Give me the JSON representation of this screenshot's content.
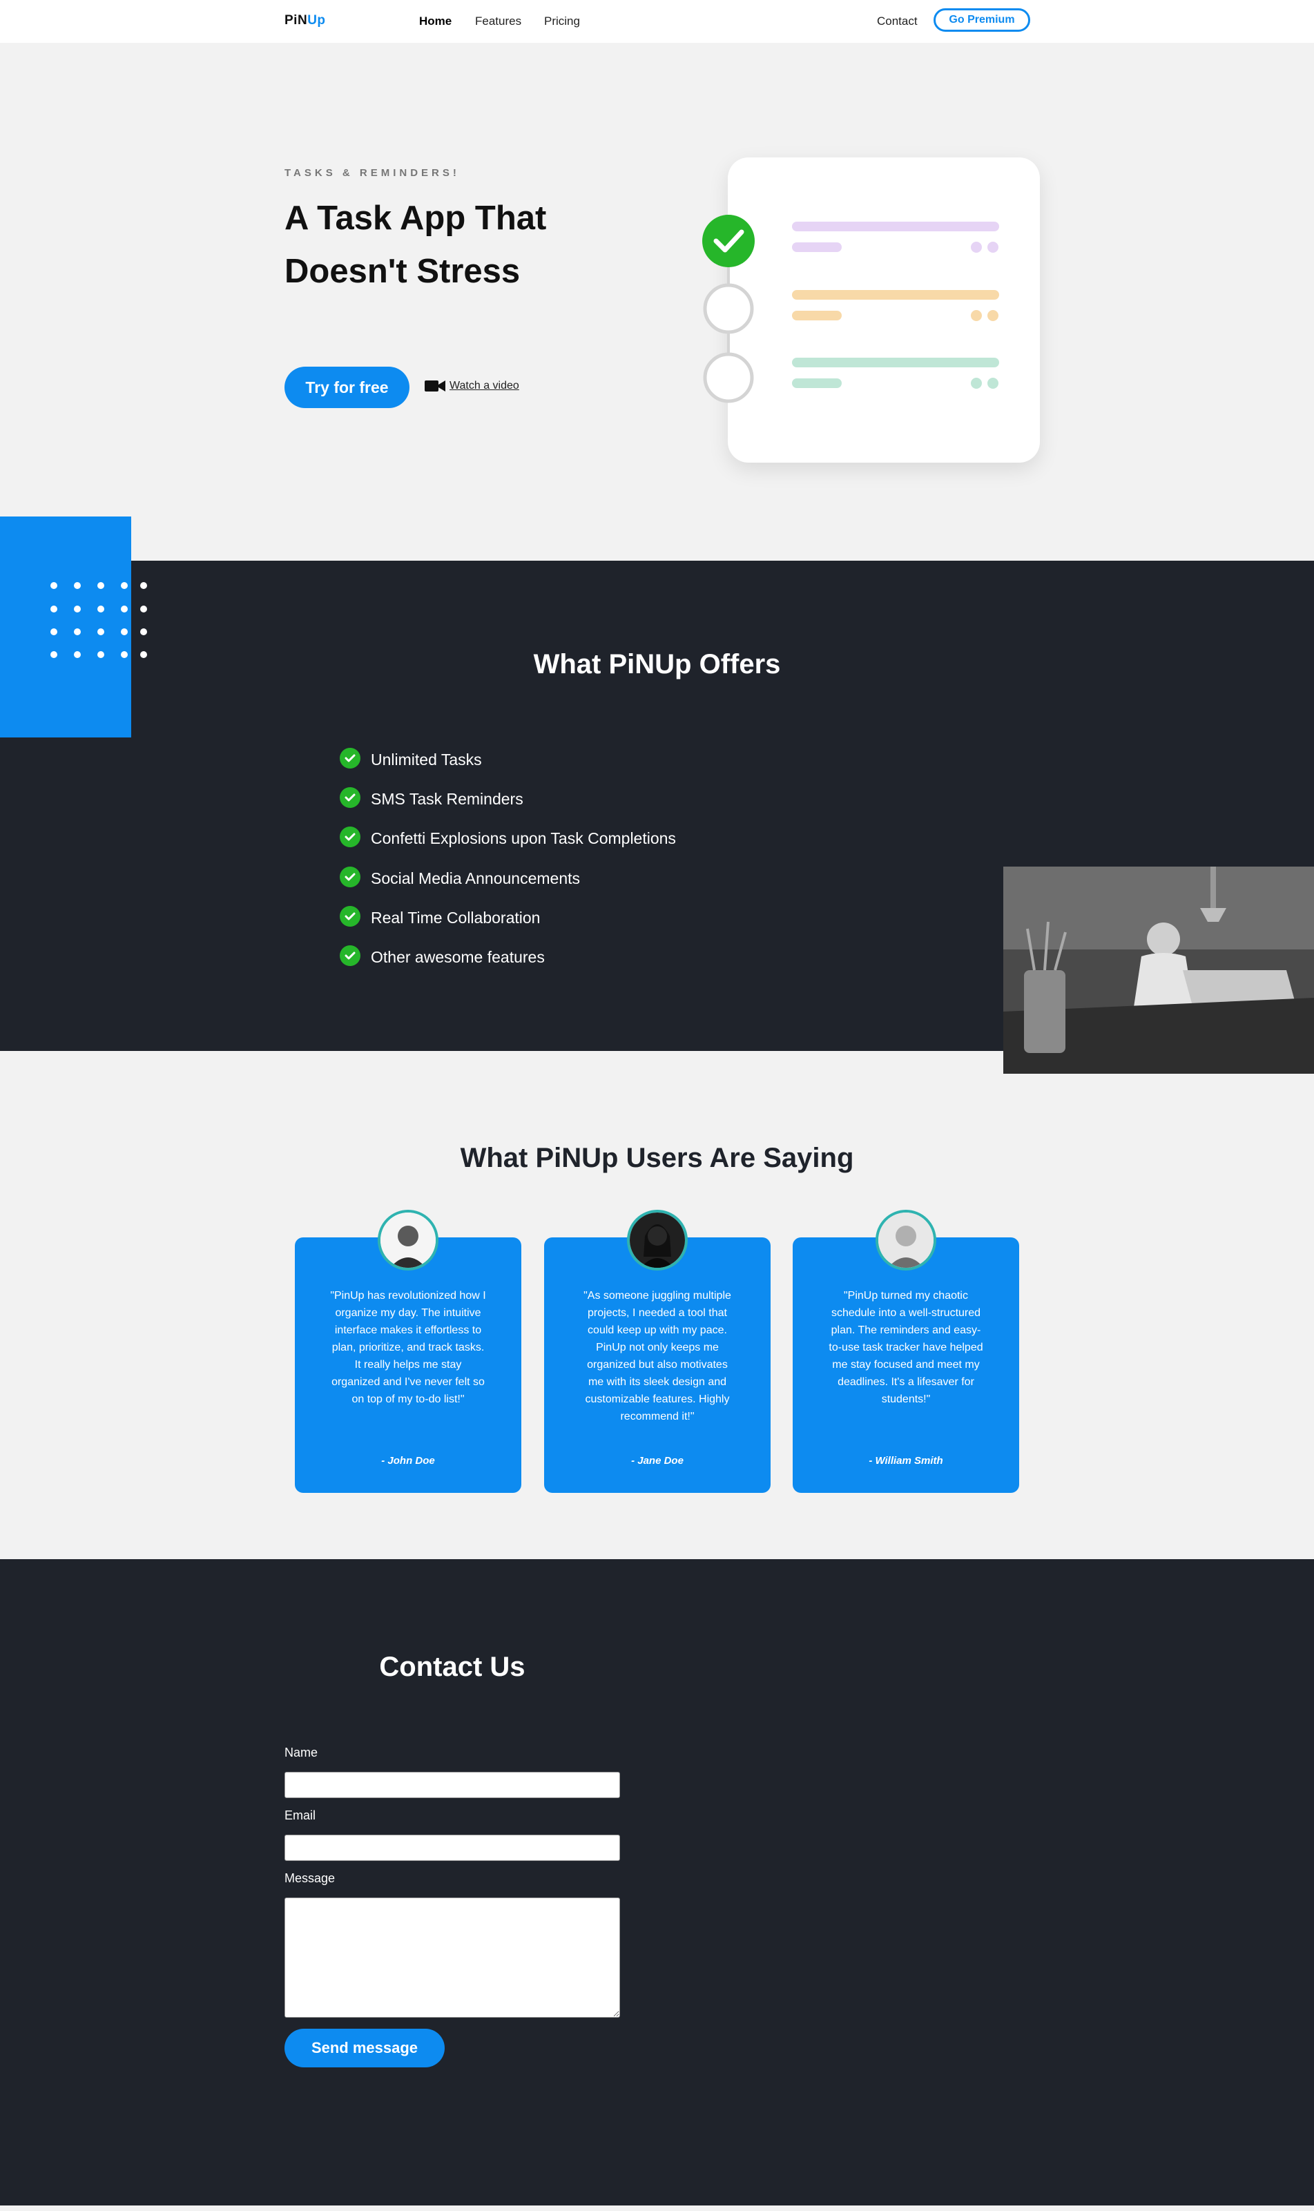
{
  "nav": {
    "logo_part1": "PiN",
    "logo_part2": "Up",
    "links": [
      "Home",
      "Features",
      "Pricing"
    ],
    "contact": "Contact",
    "premium": "Go Premium"
  },
  "hero": {
    "eyebrow": "TASKS & REMINDERS!",
    "title": "A Task App That Doesn't Stress",
    "cta": "Try for free",
    "video_link": "Watch a video",
    "task_colors": [
      "#e6d4f5",
      "#f8d9a8",
      "#bfe6d6"
    ],
    "check_color": "#26b62a"
  },
  "offers": {
    "title": "What PiNUp Offers",
    "features": [
      "Unlimited Tasks",
      "SMS Task Reminders",
      "Confetti Explosions upon Task Completions",
      "Social Media Announcements",
      "Real Time Collaboration",
      "Other awesome features"
    ]
  },
  "testimonials": {
    "title": "What PiNUp Users Are Saying",
    "items": [
      {
        "quote": "\"PinUp has revolutionized how I organize my day. The intuitive interface makes it effortless to plan, prioritize, and track tasks. It really helps me stay organized and I've never felt so on top of my to-do list!\"",
        "author": "- John Doe"
      },
      {
        "quote": "\"As someone juggling multiple projects, I needed a tool that could keep up with my pace. PinUp not only keeps me organized but also motivates me with its sleek design and customizable features. Highly recommend it!\"",
        "author": "- Jane Doe"
      },
      {
        "quote": "\"PinUp turned my chaotic schedule into a well-structured plan. The reminders and easy-to-use task tracker have helped me stay focused and meet my deadlines. It's a lifesaver for students!\"",
        "author": "- William Smith"
      }
    ]
  },
  "contact": {
    "title": "Contact Us",
    "name_label": "Name",
    "email_label": "Email",
    "message_label": "Message",
    "name_value": "",
    "email_value": "",
    "message_value": "",
    "send": "Send message"
  },
  "colors": {
    "accent": "#0d8bf0",
    "dark": "#1f232b",
    "check": "#26b62a",
    "avatar_ring": "#2fb3b0"
  }
}
